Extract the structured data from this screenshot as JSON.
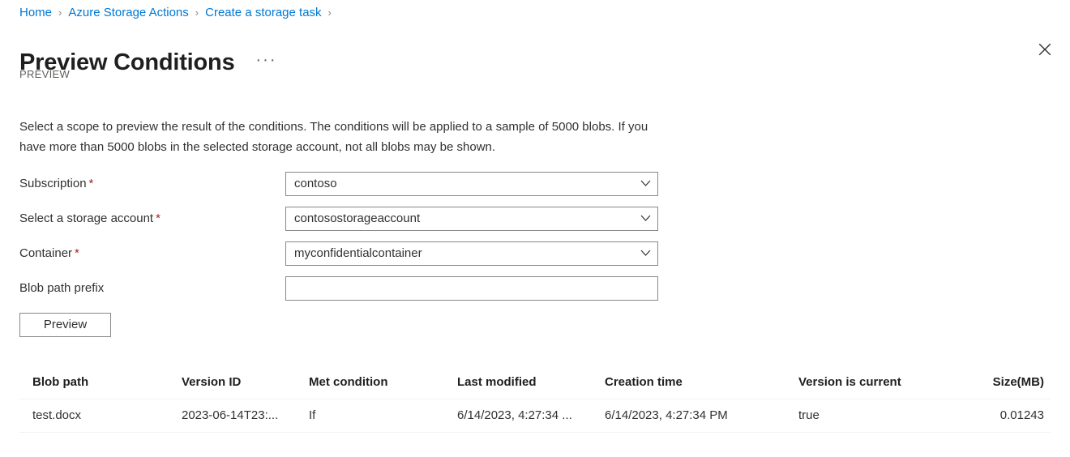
{
  "breadcrumb": {
    "separator": "›",
    "items": [
      {
        "label": "Home"
      },
      {
        "label": "Azure Storage Actions"
      },
      {
        "label": "Create a storage task"
      }
    ]
  },
  "header": {
    "title": "Preview Conditions",
    "more_menu": "···",
    "preview_tag": "PREVIEW",
    "close_label": "Close"
  },
  "description": "Select a scope to preview the result of the conditions. The conditions will be applied to a sample of 5000 blobs. If you have more than 5000 blobs in the selected storage account, not all blobs may be shown.",
  "form": {
    "fields": [
      {
        "label": "Subscription",
        "required": true,
        "required_marker": "*",
        "value": "contoso",
        "placeholder": "",
        "type": "dropdown"
      },
      {
        "label": "Select a storage account",
        "required": true,
        "required_marker": "*",
        "value": "contosostorageaccount",
        "placeholder": "",
        "type": "dropdown"
      },
      {
        "label": "Container",
        "required": true,
        "required_marker": "*",
        "value": "myconfidentialcontainer",
        "placeholder": "",
        "type": "dropdown"
      },
      {
        "label": "Blob path prefix",
        "required": false,
        "required_marker": "",
        "value": "",
        "placeholder": "",
        "type": "text"
      }
    ],
    "preview_button": "Preview"
  },
  "table": {
    "columns": [
      "Blob path",
      "Version ID",
      "Met condition",
      "Last modified",
      "Creation time",
      "Version is current",
      "Size(MB)"
    ],
    "rows": [
      {
        "blob_path": "test.docx",
        "version_id": "2023-06-14T23:...",
        "met_condition": "If",
        "last_modified": "6/14/2023, 4:27:34 ...",
        "creation_time": "6/14/2023, 4:27:34 PM",
        "version_is_current": "true",
        "size_mb": "0.01243"
      }
    ]
  },
  "colors": {
    "link": "#0078d4",
    "required": "#a4262c",
    "text": "#323130",
    "muted": "#605e5c",
    "border": "#8a8886",
    "divider": "#f3f2f1"
  }
}
